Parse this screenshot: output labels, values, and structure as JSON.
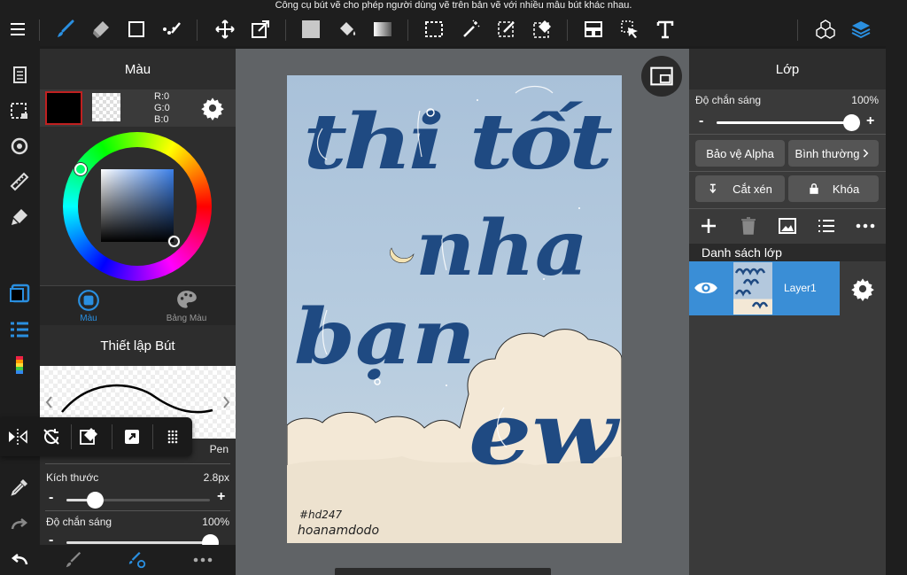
{
  "tooltip": "Công cụ bút vẽ cho phép người dùng vẽ trên bản vẽ với nhiều mẫu bút khác nhau.",
  "color_panel": {
    "title": "Màu",
    "rgb": {
      "r": "R:0",
      "g": "G:0",
      "b": "B:0"
    },
    "tabs": {
      "color": "Màu",
      "palette": "Bảng Màu"
    }
  },
  "brush_panel": {
    "title": "Thiết lập Bút",
    "brush_name": "Pen",
    "size_label": "Kích thước",
    "size_value": "2.8px",
    "size_fraction": 0.2,
    "opacity_label": "Độ chắn sáng",
    "opacity_value": "100%",
    "opacity_fraction": 1.0
  },
  "layer_panel": {
    "title": "Lớp",
    "opacity_label": "Độ chắn sáng",
    "opacity_value": "100%",
    "opacity_fraction": 1.0,
    "protect_alpha": "Bảo vệ Alpha",
    "blend_mode": "Bình thường",
    "clip": "Cắt xén",
    "lock": "Khóa",
    "list_title": "Danh sách lớp",
    "layers": [
      {
        "name": "Layer1"
      }
    ]
  },
  "artwork": {
    "line1": "thi tốt",
    "line2": "nha",
    "line3": "bạn",
    "line4": "ew",
    "signature_tag": "#hd247",
    "signature": "hoanamdodo"
  },
  "colors": {
    "accent_blue": "#2a8fe0",
    "layer_selected": "#3a8ed6",
    "primary_color": "#000000",
    "lettering_blue": "#1f4a82",
    "sky": "#b3c8dd",
    "cloud": "#f3e8d6"
  },
  "icons": {
    "menu": "menu-icon",
    "brush": "brush-icon",
    "eraser": "eraser-icon",
    "layers": "layers-icon",
    "settings": "gear-icon"
  }
}
